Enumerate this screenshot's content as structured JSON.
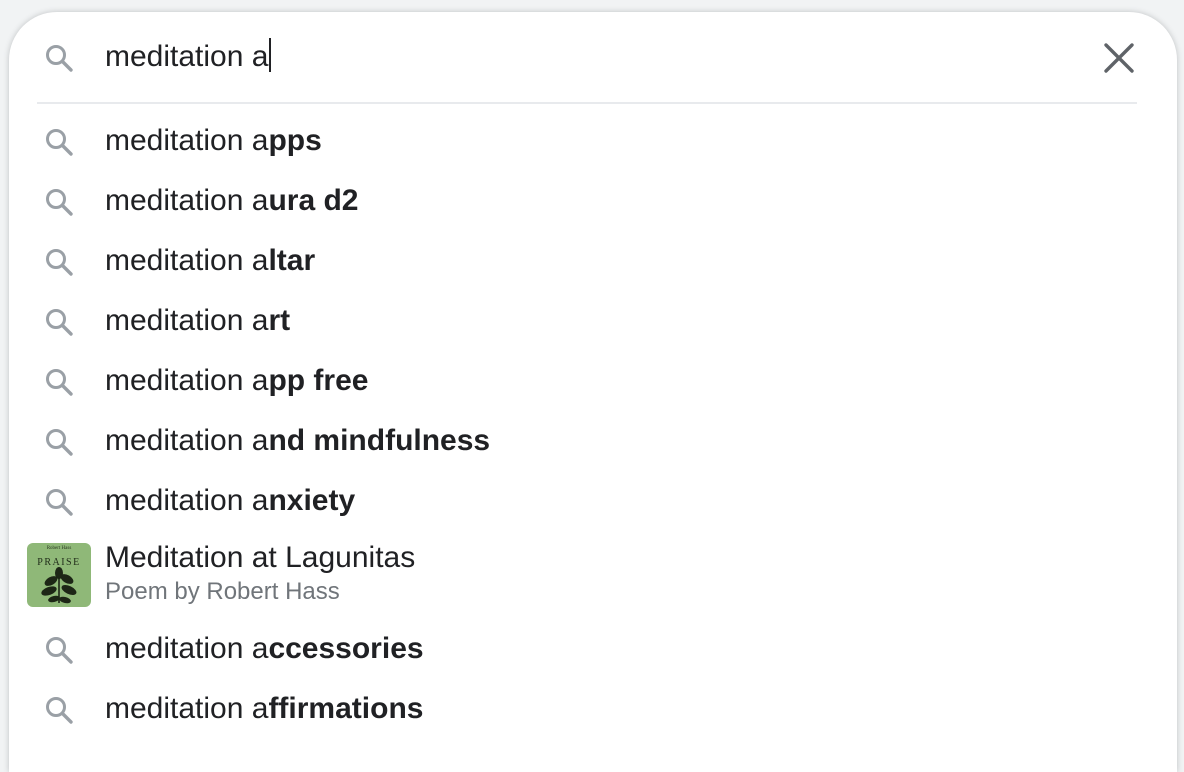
{
  "search": {
    "query": "meditation a",
    "clear_label": "Clear search"
  },
  "colors": {
    "text": "#202124",
    "secondary_text": "#70757a",
    "icon": "#9aa0a6",
    "divider": "#e8eaed",
    "thumbnail": "#8fb878"
  },
  "icons": {
    "search": "search-icon",
    "clear": "close-icon"
  },
  "suggestions": [
    {
      "prefix": "meditation a",
      "completion": "pps"
    },
    {
      "prefix": "meditation a",
      "completion": "ura d2"
    },
    {
      "prefix": "meditation a",
      "completion": "ltar"
    },
    {
      "prefix": "meditation a",
      "completion": "rt"
    },
    {
      "prefix": "meditation a",
      "completion": "pp free"
    },
    {
      "prefix": "meditation a",
      "completion": "nd mindfulness"
    },
    {
      "prefix": "meditation a",
      "completion": "nxiety"
    },
    {
      "rich": true,
      "title": "Meditation at Lagunitas",
      "subtitle": "Poem by Robert Hass",
      "thumbnail": {
        "author": "Robert Hass",
        "book_title": "PRAISE"
      }
    },
    {
      "prefix": "meditation a",
      "completion": "ccessories"
    },
    {
      "prefix": "meditation a",
      "completion": "ffirmations"
    }
  ]
}
